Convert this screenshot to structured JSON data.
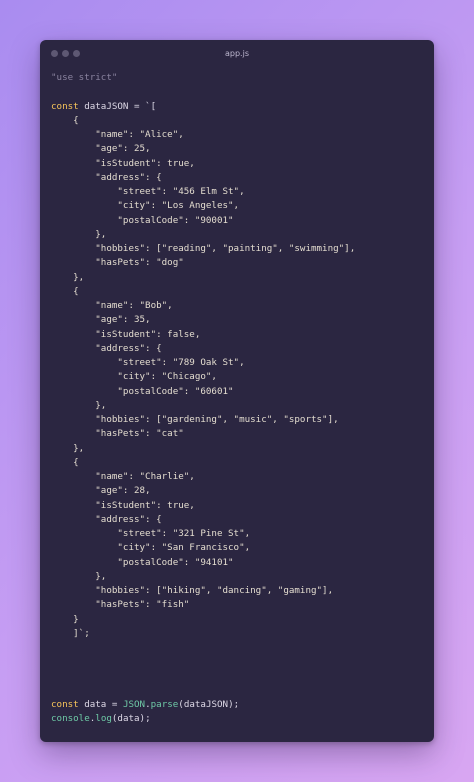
{
  "window": {
    "title": "app.js",
    "controls": [
      "window-dot",
      "window-dot",
      "window-dot"
    ]
  },
  "code_lines": [
    [
      {
        "t": "\"use strict\"",
        "c": "comment"
      }
    ],
    [],
    [
      {
        "t": "const",
        "c": "kw"
      },
      {
        "t": " dataJSON = `[",
        "c": "plain"
      }
    ],
    [
      {
        "t": "    {",
        "c": "str"
      }
    ],
    [
      {
        "t": "        \"name\": \"Alice\",",
        "c": "str"
      }
    ],
    [
      {
        "t": "        \"age\": 25,",
        "c": "str"
      }
    ],
    [
      {
        "t": "        \"isStudent\": true,",
        "c": "str"
      }
    ],
    [
      {
        "t": "        \"address\": {",
        "c": "str"
      }
    ],
    [
      {
        "t": "            \"street\": \"456 Elm St\",",
        "c": "str"
      }
    ],
    [
      {
        "t": "            \"city\": \"Los Angeles\",",
        "c": "str"
      }
    ],
    [
      {
        "t": "            \"postalCode\": \"90001\"",
        "c": "str"
      }
    ],
    [
      {
        "t": "        },",
        "c": "str"
      }
    ],
    [
      {
        "t": "        \"hobbies\": [\"reading\", \"painting\", \"swimming\"],",
        "c": "str"
      }
    ],
    [
      {
        "t": "        \"hasPets\": \"dog\"",
        "c": "str"
      }
    ],
    [
      {
        "t": "    },",
        "c": "str"
      }
    ],
    [
      {
        "t": "    {",
        "c": "str"
      }
    ],
    [
      {
        "t": "        \"name\": \"Bob\",",
        "c": "str"
      }
    ],
    [
      {
        "t": "        \"age\": 35,",
        "c": "str"
      }
    ],
    [
      {
        "t": "        \"isStudent\": false,",
        "c": "str"
      }
    ],
    [
      {
        "t": "        \"address\": {",
        "c": "str"
      }
    ],
    [
      {
        "t": "            \"street\": \"789 Oak St\",",
        "c": "str"
      }
    ],
    [
      {
        "t": "            \"city\": \"Chicago\",",
        "c": "str"
      }
    ],
    [
      {
        "t": "            \"postalCode\": \"60601\"",
        "c": "str"
      }
    ],
    [
      {
        "t": "        },",
        "c": "str"
      }
    ],
    [
      {
        "t": "        \"hobbies\": [\"gardening\", \"music\", \"sports\"],",
        "c": "str"
      }
    ],
    [
      {
        "t": "        \"hasPets\": \"cat\"",
        "c": "str"
      }
    ],
    [
      {
        "t": "    },",
        "c": "str"
      }
    ],
    [
      {
        "t": "    {",
        "c": "str"
      }
    ],
    [
      {
        "t": "        \"name\": \"Charlie\",",
        "c": "str"
      }
    ],
    [
      {
        "t": "        \"age\": 28,",
        "c": "str"
      }
    ],
    [
      {
        "t": "        \"isStudent\": true,",
        "c": "str"
      }
    ],
    [
      {
        "t": "        \"address\": {",
        "c": "str"
      }
    ],
    [
      {
        "t": "            \"street\": \"321 Pine St\",",
        "c": "str"
      }
    ],
    [
      {
        "t": "            \"city\": \"San Francisco\",",
        "c": "str"
      }
    ],
    [
      {
        "t": "            \"postalCode\": \"94101\"",
        "c": "str"
      }
    ],
    [
      {
        "t": "        },",
        "c": "str"
      }
    ],
    [
      {
        "t": "        \"hobbies\": [\"hiking\", \"dancing\", \"gaming\"],",
        "c": "str"
      }
    ],
    [
      {
        "t": "        \"hasPets\": \"fish\"",
        "c": "str"
      }
    ],
    [
      {
        "t": "    }",
        "c": "str"
      }
    ],
    [
      {
        "t": "    ]`;",
        "c": "str"
      }
    ],
    [],
    [],
    [],
    [],
    [
      {
        "t": "const",
        "c": "kw"
      },
      {
        "t": " data = ",
        "c": "plain"
      },
      {
        "t": "JSON",
        "c": "fn"
      },
      {
        "t": ".",
        "c": "plain"
      },
      {
        "t": "parse",
        "c": "fn"
      },
      {
        "t": "(dataJSON);",
        "c": "plain"
      }
    ],
    [
      {
        "t": "console",
        "c": "fn"
      },
      {
        "t": ".",
        "c": "plain"
      },
      {
        "t": "log",
        "c": "fn"
      },
      {
        "t": "(data);",
        "c": "plain"
      }
    ]
  ]
}
